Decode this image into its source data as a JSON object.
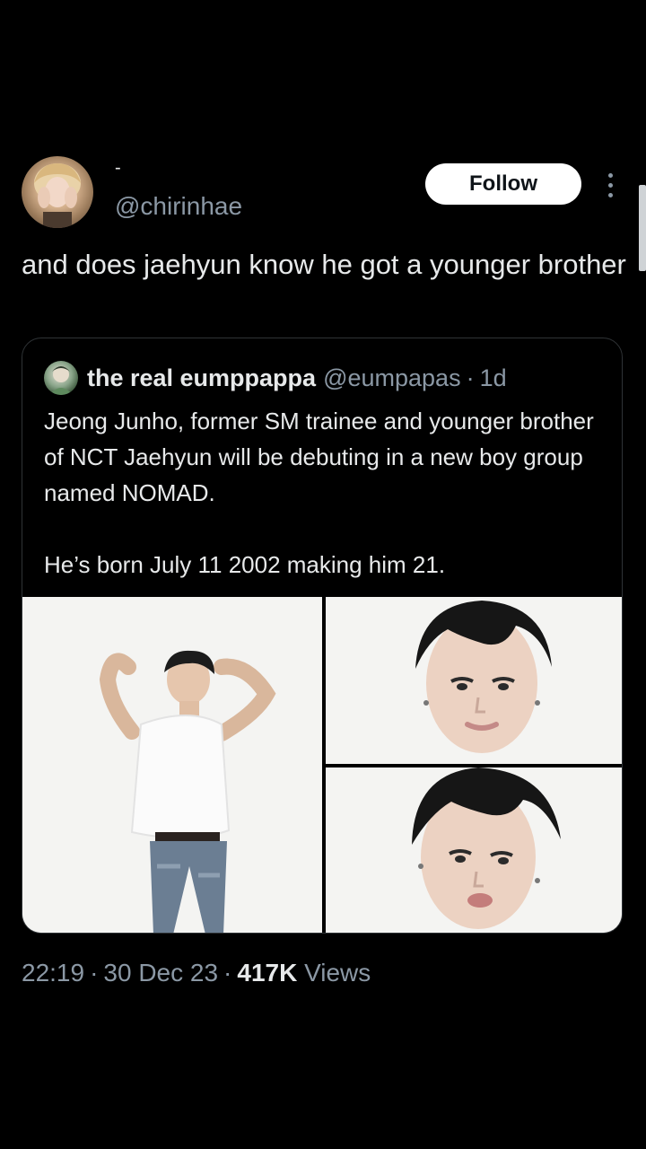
{
  "author": {
    "display_name": "-",
    "handle": "@chirinhae",
    "avatar_icon": "profile-photo-avatar",
    "follow_label": "Follow"
  },
  "tweet": {
    "text": "and does jaehyun know he got a younger brother"
  },
  "quote": {
    "name": "the real eumppappa",
    "handle": "@eumpapas",
    "separator": "·",
    "time": "1d",
    "text": "Jeong Junho, former SM trainee and younger brother of NCT Jaehyun will be debuting in a new boy group named NOMAD.\n\nHe’s born July 11 2002 making him 21.",
    "media_count": 3
  },
  "meta": {
    "time": "22:19",
    "date": "30 Dec 23",
    "separator": "·",
    "views_count": "417K",
    "views_label": "Views"
  },
  "colors": {
    "background": "#000000",
    "text_primary": "#e7e9ea",
    "text_secondary": "#8b98a5",
    "border": "#2f3336",
    "follow_bg": "#ffffff"
  }
}
